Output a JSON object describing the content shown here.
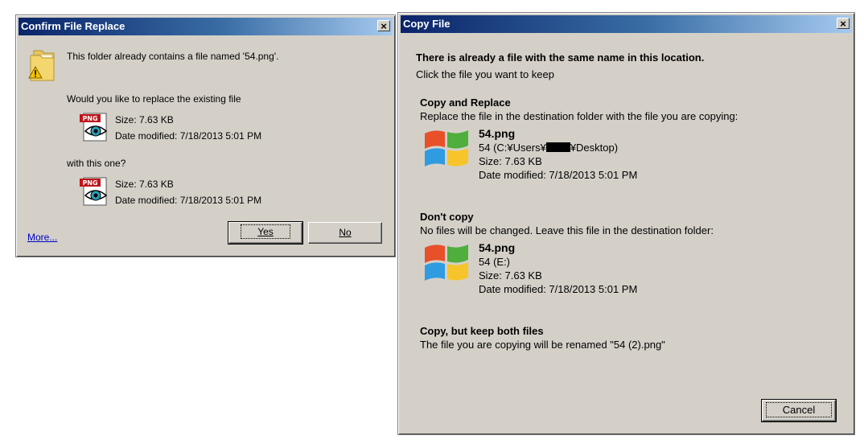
{
  "confirm_dialog": {
    "title": "Confirm File Replace",
    "close_glyph": "×",
    "message": "This folder already contains a file named '54.png'.",
    "question": "Would you like to replace the existing file",
    "existing": {
      "size": "Size: 7.63 KB",
      "date": "Date modified: 7/18/2013 5:01 PM",
      "icon_text": "PNG"
    },
    "with_label": "with this one?",
    "incoming": {
      "size": "Size: 7.63 KB",
      "date": "Date modified: 7/18/2013 5:01 PM",
      "icon_text": "PNG"
    },
    "more_link": "More...",
    "yes_label": "Yes",
    "no_label": "No"
  },
  "copy_dialog": {
    "title": "Copy File",
    "close_glyph": "×",
    "heading": "There is already a file with the same name in this location.",
    "subheading": "Click the file you want to keep",
    "options": [
      {
        "title": "Copy and Replace",
        "description": "Replace the file in the destination folder with the file you are copying:",
        "file_name": "54.png",
        "location_prefix": "54 (C:¥Users¥",
        "location_suffix": "¥Desktop)",
        "size": "Size: 7.63 KB",
        "date": "Date modified: 7/18/2013 5:01 PM"
      },
      {
        "title": "Don't copy",
        "description": "No files will be changed. Leave this file in the destination folder:",
        "file_name": "54.png",
        "location": "54 (E:)",
        "size": "Size: 7.63 KB",
        "date": "Date modified: 7/18/2013 5:01 PM"
      },
      {
        "title": "Copy, but keep both files",
        "description": "The file you are copying will be renamed \"54 (2).png\""
      }
    ],
    "cancel_label": "Cancel"
  },
  "colors": {
    "dialog_face": "#d4d0c8",
    "title_start": "#0a246a",
    "title_end": "#a6caf0",
    "link": "#0000cc"
  },
  "icons": {
    "folder_warning": "folder-warning-icon",
    "png_file": "png-file-icon",
    "windows_logo": "windows-logo-icon"
  }
}
